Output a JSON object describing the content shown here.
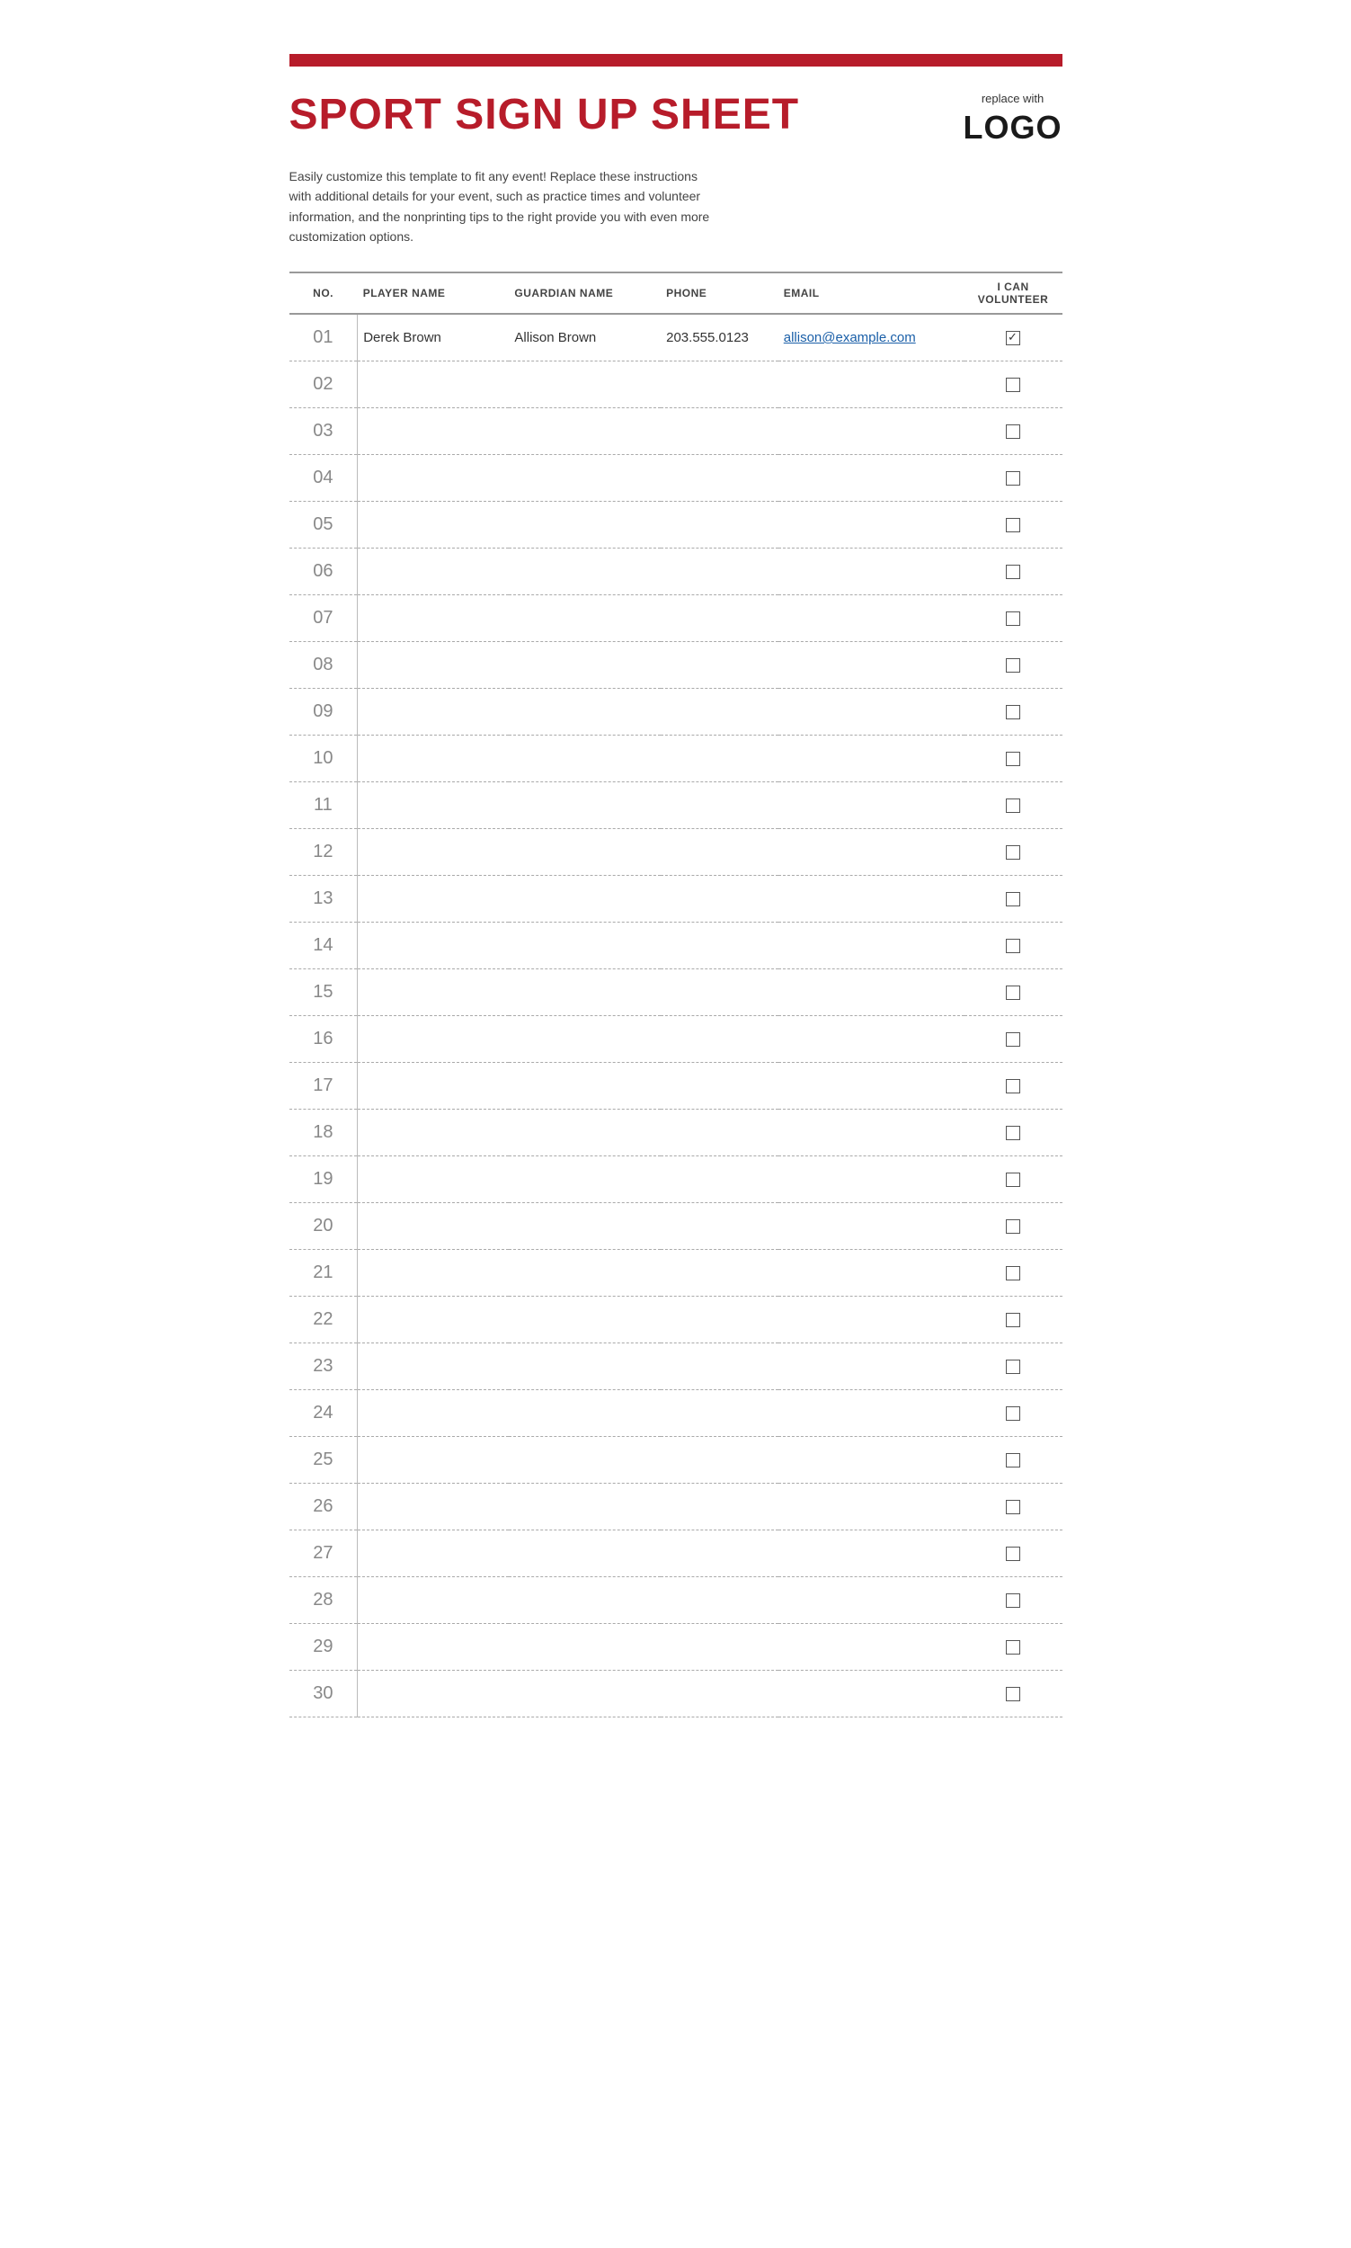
{
  "page": {
    "top_bar_color": "#b71c2a",
    "title": "SPORT SIGN UP SHEET",
    "logo_replace": "replace with",
    "logo_text": "LOGO",
    "description": "Easily customize this template to fit any event! Replace these instructions with additional details for your event, such as practice times and volunteer information, and the nonprinting tips to the right provide you with even more customization options.",
    "table": {
      "headers": [
        "NO.",
        "PLAYER NAME",
        "GUARDIAN NAME",
        "PHONE",
        "EMAIL",
        "I CAN VOLUNTEER"
      ],
      "rows": [
        {
          "no": "01",
          "player": "Derek Brown",
          "guardian": "Allison Brown",
          "phone": "203.555.0123",
          "email": "allison@example.com",
          "volunteer": true
        },
        {
          "no": "02",
          "player": "",
          "guardian": "",
          "phone": "",
          "email": "",
          "volunteer": false
        },
        {
          "no": "03",
          "player": "",
          "guardian": "",
          "phone": "",
          "email": "",
          "volunteer": false
        },
        {
          "no": "04",
          "player": "",
          "guardian": "",
          "phone": "",
          "email": "",
          "volunteer": false
        },
        {
          "no": "05",
          "player": "",
          "guardian": "",
          "phone": "",
          "email": "",
          "volunteer": false
        },
        {
          "no": "06",
          "player": "",
          "guardian": "",
          "phone": "",
          "email": "",
          "volunteer": false
        },
        {
          "no": "07",
          "player": "",
          "guardian": "",
          "phone": "",
          "email": "",
          "volunteer": false
        },
        {
          "no": "08",
          "player": "",
          "guardian": "",
          "phone": "",
          "email": "",
          "volunteer": false
        },
        {
          "no": "09",
          "player": "",
          "guardian": "",
          "phone": "",
          "email": "",
          "volunteer": false
        },
        {
          "no": "10",
          "player": "",
          "guardian": "",
          "phone": "",
          "email": "",
          "volunteer": false
        },
        {
          "no": "11",
          "player": "",
          "guardian": "",
          "phone": "",
          "email": "",
          "volunteer": false
        },
        {
          "no": "12",
          "player": "",
          "guardian": "",
          "phone": "",
          "email": "",
          "volunteer": false
        },
        {
          "no": "13",
          "player": "",
          "guardian": "",
          "phone": "",
          "email": "",
          "volunteer": false
        },
        {
          "no": "14",
          "player": "",
          "guardian": "",
          "phone": "",
          "email": "",
          "volunteer": false
        },
        {
          "no": "15",
          "player": "",
          "guardian": "",
          "phone": "",
          "email": "",
          "volunteer": false
        },
        {
          "no": "16",
          "player": "",
          "guardian": "",
          "phone": "",
          "email": "",
          "volunteer": false
        },
        {
          "no": "17",
          "player": "",
          "guardian": "",
          "phone": "",
          "email": "",
          "volunteer": false
        },
        {
          "no": "18",
          "player": "",
          "guardian": "",
          "phone": "",
          "email": "",
          "volunteer": false
        },
        {
          "no": "19",
          "player": "",
          "guardian": "",
          "phone": "",
          "email": "",
          "volunteer": false
        },
        {
          "no": "20",
          "player": "",
          "guardian": "",
          "phone": "",
          "email": "",
          "volunteer": false
        },
        {
          "no": "21",
          "player": "",
          "guardian": "",
          "phone": "",
          "email": "",
          "volunteer": false
        },
        {
          "no": "22",
          "player": "",
          "guardian": "",
          "phone": "",
          "email": "",
          "volunteer": false
        },
        {
          "no": "23",
          "player": "",
          "guardian": "",
          "phone": "",
          "email": "",
          "volunteer": false
        },
        {
          "no": "24",
          "player": "",
          "guardian": "",
          "phone": "",
          "email": "",
          "volunteer": false
        },
        {
          "no": "25",
          "player": "",
          "guardian": "",
          "phone": "",
          "email": "",
          "volunteer": false
        },
        {
          "no": "26",
          "player": "",
          "guardian": "",
          "phone": "",
          "email": "",
          "volunteer": false
        },
        {
          "no": "27",
          "player": "",
          "guardian": "",
          "phone": "",
          "email": "",
          "volunteer": false
        },
        {
          "no": "28",
          "player": "",
          "guardian": "",
          "phone": "",
          "email": "",
          "volunteer": false
        },
        {
          "no": "29",
          "player": "",
          "guardian": "",
          "phone": "",
          "email": "",
          "volunteer": false
        },
        {
          "no": "30",
          "player": "",
          "guardian": "",
          "phone": "",
          "email": "",
          "volunteer": false
        }
      ]
    }
  }
}
